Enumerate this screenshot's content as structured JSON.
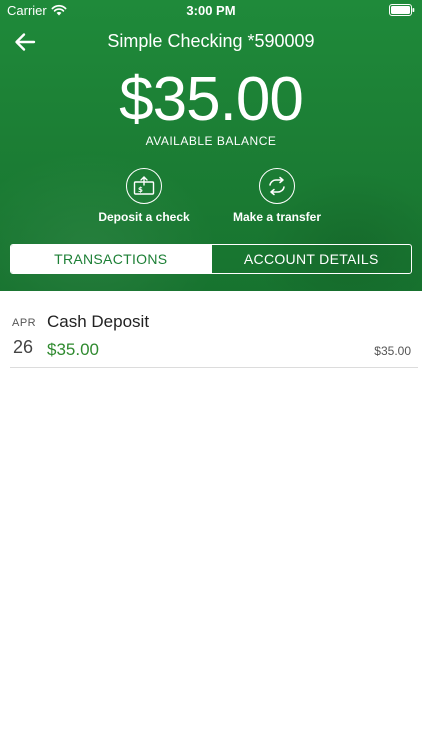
{
  "status_bar": {
    "carrier": "Carrier",
    "time": "3:00 PM"
  },
  "nav": {
    "title": "Simple Checking *590009"
  },
  "account": {
    "balance": "$35.00",
    "balance_label": "AVAILABLE BALANCE"
  },
  "actions": [
    {
      "label": "Deposit a check",
      "icon": "deposit-check-icon"
    },
    {
      "label": "Make a transfer",
      "icon": "transfer-icon"
    }
  ],
  "tabs": [
    {
      "label": "TRANSACTIONS",
      "active": true
    },
    {
      "label": "ACCOUNT DETAILS",
      "active": false
    }
  ],
  "transactions": [
    {
      "month": "APR",
      "day": "26",
      "description": "Cash Deposit",
      "amount": "$35.00",
      "running_balance": "$35.00"
    }
  ],
  "colors": {
    "brand_green": "#1c7f35",
    "amount_green": "#2f8a2f",
    "divider": "#dcdcdc"
  }
}
